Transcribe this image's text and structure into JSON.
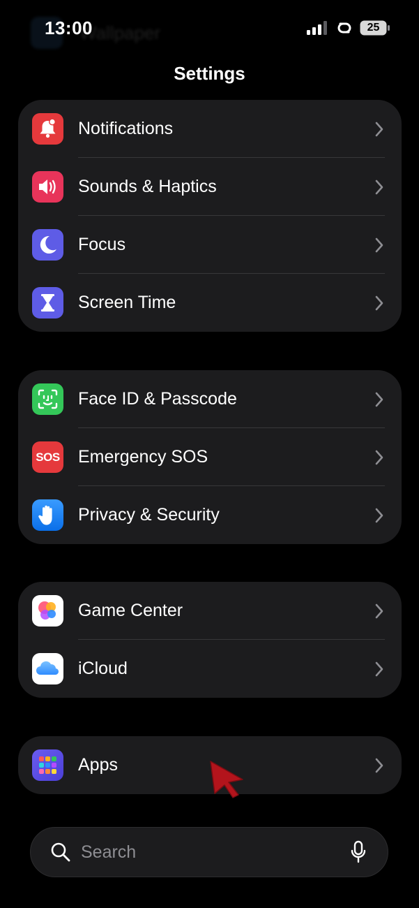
{
  "status_bar": {
    "time": "13:00",
    "battery_level": "25",
    "background_app_label": "Wallpaper"
  },
  "header": {
    "title": "Settings"
  },
  "groups": [
    {
      "items": [
        {
          "label": "Notifications",
          "icon": "bell-badge-icon",
          "icon_color": "#e5393c"
        },
        {
          "label": "Sounds & Haptics",
          "icon": "speaker-icon",
          "icon_color": "#e8345a"
        },
        {
          "label": "Focus",
          "icon": "moon-icon",
          "icon_color": "#5e5ce6"
        },
        {
          "label": "Screen Time",
          "icon": "hourglass-icon",
          "icon_color": "#5e5ce6"
        }
      ]
    },
    {
      "items": [
        {
          "label": "Face ID & Passcode",
          "icon": "face-id-icon",
          "icon_color": "#34c759"
        },
        {
          "label": "Emergency SOS",
          "icon": "sos-icon",
          "icon_color": "#e5393c",
          "icon_text": "SOS"
        },
        {
          "label": "Privacy & Security",
          "icon": "hand-icon",
          "icon_color": "#1a84ff"
        }
      ]
    },
    {
      "items": [
        {
          "label": "Game Center",
          "icon": "game-center-icon",
          "icon_color": "#ffffff"
        },
        {
          "label": "iCloud",
          "icon": "cloud-icon",
          "icon_color": "#ffffff"
        }
      ]
    },
    {
      "items": [
        {
          "label": "Apps",
          "icon": "apps-grid-icon",
          "icon_color": "#5e5ce6"
        }
      ]
    }
  ],
  "search": {
    "placeholder": "Search"
  },
  "colors": {
    "background": "#000000",
    "group_background": "#1c1c1e",
    "divider": "#38383a",
    "chevron": "#8e8e93",
    "cursor": "#b3141c"
  }
}
